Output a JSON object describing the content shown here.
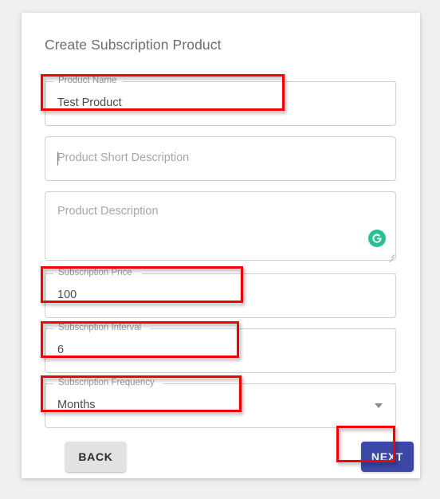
{
  "page": {
    "title": "Create Subscription Product",
    "background_color": "#f0f0f0",
    "card_color": "#ffffff"
  },
  "form": {
    "fields": [
      {
        "name": "product-name",
        "label": "Product Name",
        "value": "Test Product",
        "placeholder": "",
        "type": "text",
        "highlighted": true
      },
      {
        "name": "product-short-description",
        "label": "",
        "value": "",
        "placeholder": "Product Short Description",
        "type": "text",
        "highlighted": false
      },
      {
        "name": "product-description",
        "label": "",
        "value": "",
        "placeholder": "Product Description",
        "type": "textarea",
        "highlighted": false
      },
      {
        "name": "subscription-price",
        "label": "Subscription Price",
        "value": "100",
        "placeholder": "",
        "type": "text",
        "highlighted": true
      },
      {
        "name": "subscription-interval",
        "label": "Subscription Interval",
        "value": "6",
        "placeholder": "",
        "type": "text",
        "highlighted": true
      },
      {
        "name": "subscription-frequency",
        "label": "Subscription Frequency",
        "value": "Months",
        "placeholder": "",
        "type": "select",
        "highlighted": true
      }
    ]
  },
  "actions": {
    "back_label": "BACK",
    "next_label": "NEXT",
    "next_color": "#3c47a8",
    "back_color": "#e2e2e2"
  },
  "overlays": {
    "annotation_color": "#f20000",
    "annotation_count": 5
  },
  "widgets": {
    "grammarly_icon": "grammarly-g-icon",
    "grammarly_color": "#2bbf93",
    "dropdown_icon": "chevron-down-icon",
    "resize_icon": "resize-handle-icon"
  }
}
